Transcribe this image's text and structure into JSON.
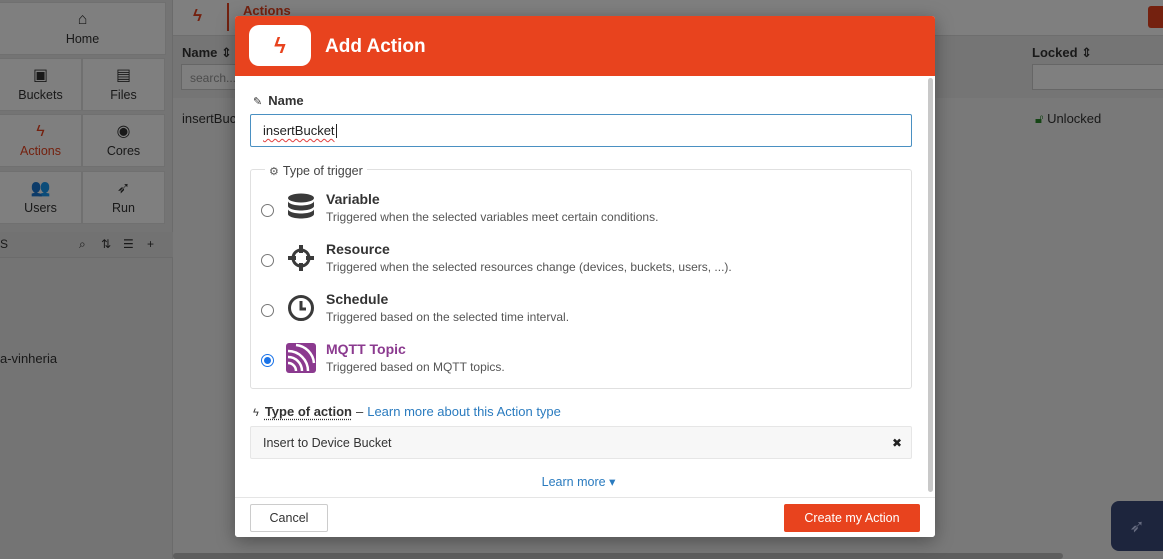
{
  "sidebar": {
    "nav": [
      {
        "label": "Home",
        "icon": "home-icon"
      },
      {
        "label": "Buckets",
        "icon": "bucket-icon"
      },
      {
        "label": "Files",
        "icon": "file-icon"
      },
      {
        "label": "Actions",
        "icon": "bolt-icon"
      },
      {
        "label": "Cores",
        "icon": "cores-icon"
      },
      {
        "label": "Users",
        "icon": "users-icon"
      },
      {
        "label": "Run",
        "icon": "rocket-icon"
      }
    ],
    "tools_label": "S",
    "list_item": "a-vinheria"
  },
  "topbar": {
    "title": "Actions"
  },
  "table": {
    "headers": {
      "name": "Name ⇕",
      "locked": "Locked ⇕"
    },
    "search_placeholder": "search...",
    "row": {
      "name": "insertBuck",
      "locked": "Unlocked"
    }
  },
  "modal": {
    "title": "Add Action",
    "name_label": "Name",
    "name_value": "insertBucket",
    "trigger_legend": "Type of trigger",
    "triggers": [
      {
        "name": "Variable",
        "desc": "Triggered when the selected variables meet certain conditions.",
        "icon": "database-icon",
        "selected": false
      },
      {
        "name": "Resource",
        "desc": "Triggered when the selected resources change (devices, buckets, users, ...).",
        "icon": "crosshair-icon",
        "selected": false
      },
      {
        "name": "Schedule",
        "desc": "Triggered based on the selected time interval.",
        "icon": "clock-icon",
        "selected": false
      },
      {
        "name": "MQTT Topic",
        "desc": "Triggered based on MQTT topics.",
        "icon": "mqtt-icon",
        "selected": true
      }
    ],
    "action_type_label": "Type of action",
    "action_type_link": "Learn more about this Action type",
    "action_type_value": "Insert to Device Bucket",
    "learn_more": "Learn more",
    "cancel": "Cancel",
    "create": "Create my Action"
  },
  "colors": {
    "accent": "#e8431e",
    "link": "#2a7bbf",
    "mqtt": "#8b3a8f"
  }
}
